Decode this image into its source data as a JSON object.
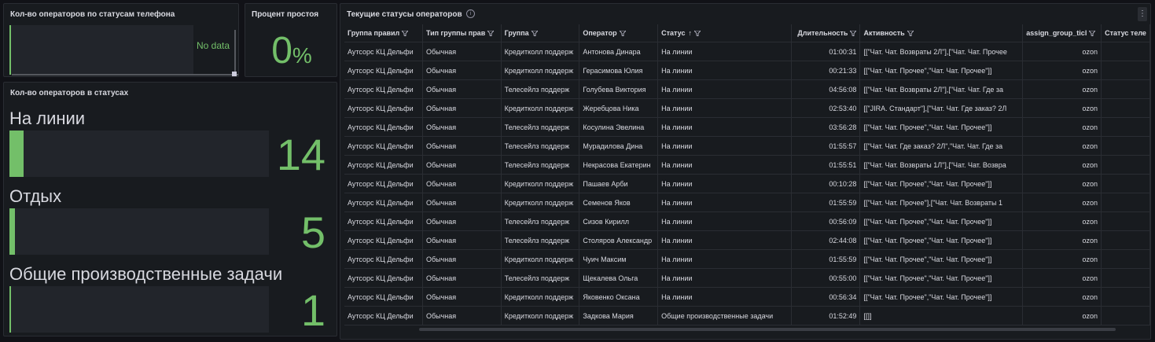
{
  "panel_phone": {
    "title": "Кол-во операторов по статусам телефона",
    "no_data": "No data"
  },
  "panel_idle": {
    "title": "Процент простоя",
    "value": "0",
    "unit": "%"
  },
  "panel_statuses": {
    "title": "Кол-во операторов в статусах",
    "items": [
      {
        "label": "На линии",
        "value": "14",
        "fill": 0.055
      },
      {
        "label": "Отдых",
        "value": "5",
        "fill": 0.02
      },
      {
        "label": "Общие производственные задачи",
        "value": "1",
        "fill": 0.005
      }
    ]
  },
  "panel_table": {
    "title": "Текущие статусы операторов",
    "info_icon": "info-icon",
    "menu_icon": "⋮",
    "columns": [
      "Группа правил",
      "Тип группы прав",
      "Группа",
      "Оператор",
      "Статус",
      "Длительность",
      "Активность",
      "assign_group_ticl",
      "Статус теле"
    ],
    "sort_indicator": "↑",
    "rows": [
      [
        "Аутсорс КЦ Дельфи",
        "Обычная",
        "Кредитколл поддерж",
        "Антонова Динара",
        "На линии",
        "01:00:31",
        "[[\"Чат. Чат. Возвраты 2Л\"],[\"Чат. Чат. Прочее",
        "ozon",
        ""
      ],
      [
        "Аутсорс КЦ Дельфи",
        "Обычная",
        "Кредитколл поддерж",
        "Герасимова Юлия",
        "На линии",
        "00:21:33",
        "[[\"Чат. Чат. Прочее\",\"Чат. Чат. Прочее\"]]",
        "ozon",
        ""
      ],
      [
        "Аутсорс КЦ Дельфи",
        "Обычная",
        "Телесейлз поддерж",
        "Голубева Виктория",
        "На линии",
        "04:56:08",
        "[[\"Чат. Чат. Возвраты 2Л\"],[\"Чат. Чат. Где за",
        "ozon",
        ""
      ],
      [
        "Аутсорс КЦ Дельфи",
        "Обычная",
        "Кредитколл поддерж",
        "Жеребцова Ника",
        "На линии",
        "02:53:40",
        "[[\"JIRA. Стандарт\"],[\"Чат. Чат. Где заказ? 2Л",
        "ozon",
        ""
      ],
      [
        "Аутсорс КЦ Дельфи",
        "Обычная",
        "Телесейлз поддерж",
        "Косулина Эвелина",
        "На линии",
        "03:56:28",
        "[[\"Чат. Чат. Прочее\",\"Чат. Чат. Прочее\"]]",
        "ozon",
        ""
      ],
      [
        "Аутсорс КЦ Дельфи",
        "Обычная",
        "Телесейлз поддерж",
        "Мурадилова Дина",
        "На линии",
        "01:55:57",
        "[[\"Чат. Чат. Где заказ? 2Л\",\"Чат. Чат. Где за",
        "ozon",
        ""
      ],
      [
        "Аутсорс КЦ Дельфи",
        "Обычная",
        "Телесейлз поддерж",
        "Некрасова Екатерин",
        "На линии",
        "01:55:51",
        "[[\"Чат. Чат. Возвраты 1Л\"],[\"Чат. Чат. Возвра",
        "ozon",
        ""
      ],
      [
        "Аутсорс КЦ Дельфи",
        "Обычная",
        "Кредитколл поддерж",
        "Пашаев Арби",
        "На линии",
        "00:10:28",
        "[[\"Чат. Чат. Прочее\",\"Чат. Чат. Прочее\"]]",
        "ozon",
        ""
      ],
      [
        "Аутсорс КЦ Дельфи",
        "Обычная",
        "Кредитколл поддерж",
        "Семенов Яков",
        "На линии",
        "01:55:59",
        "[[\"Чат. Чат. Прочее\"],[\"Чат. Чат. Возвраты 1",
        "ozon",
        ""
      ],
      [
        "Аутсорс КЦ Дельфи",
        "Обычная",
        "Телесейлз поддерж",
        "Сизов Кирилл",
        "На линии",
        "00:56:09",
        "[[\"Чат. Чат. Прочее\",\"Чат. Чат. Прочее\"]]",
        "ozon",
        ""
      ],
      [
        "Аутсорс КЦ Дельфи",
        "Обычная",
        "Телесейлз поддерж",
        "Столяров Александр",
        "На линии",
        "02:44:08",
        "[[\"Чат. Чат. Прочее\",\"Чат. Чат. Прочее\"]]",
        "ozon",
        ""
      ],
      [
        "Аутсорс КЦ Дельфи",
        "Обычная",
        "Кредитколл поддерж",
        "Чуич Максим",
        "На линии",
        "01:55:59",
        "[[\"Чат. Чат. Прочее\",\"Чат. Чат. Прочее\"]]",
        "ozon",
        ""
      ],
      [
        "Аутсорс КЦ Дельфи",
        "Обычная",
        "Телесейлз поддерж",
        "Щекалева Ольга",
        "На линии",
        "00:55:00",
        "[[\"Чат. Чат. Прочее\",\"Чат. Чат. Прочее\"]]",
        "ozon",
        ""
      ],
      [
        "Аутсорс КЦ Дельфи",
        "Обычная",
        "Кредитколл поддерж",
        "Яковенко Оксана",
        "На линии",
        "00:56:34",
        "[[\"Чат. Чат. Прочее\",\"Чат. Чат. Прочее\"]]",
        "ozon",
        ""
      ],
      [
        "Аутсорс КЦ Дельфи",
        "Обычная",
        "Кредитколл поддерж",
        "Задкова Мария",
        "Общие производственные задачи",
        "01:52:49",
        "[[]]",
        "ozon",
        ""
      ]
    ]
  },
  "colors": {
    "accent": "#73bf69",
    "panel_bg": "#181b1f",
    "page_bg": "#111217"
  }
}
